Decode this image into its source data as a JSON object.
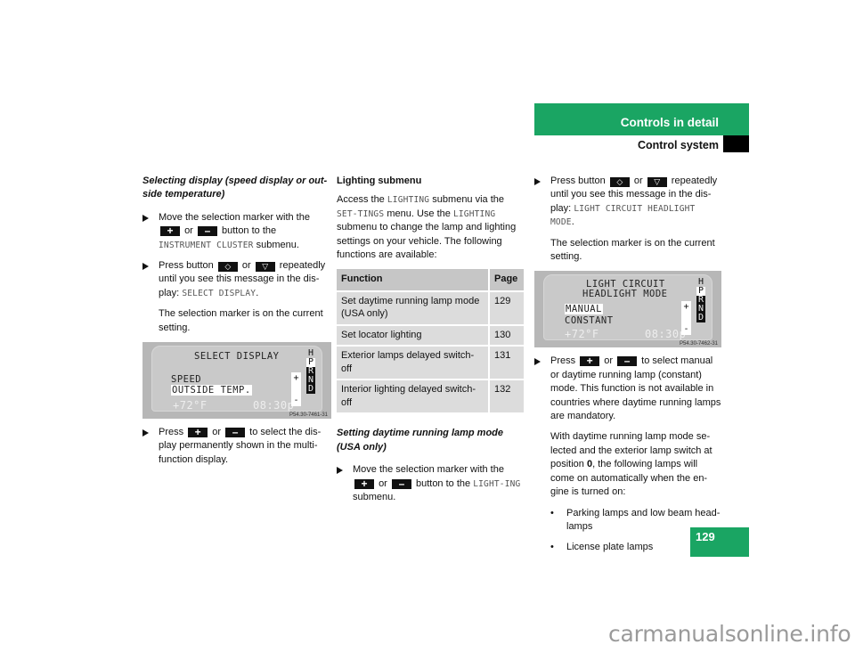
{
  "header": {
    "section": "Controls in detail",
    "subsection": "Control system"
  },
  "page_number": "129",
  "watermark": "carmanualsonline.info",
  "keys": {
    "plus": "+",
    "minus": "–",
    "up": "◇",
    "down": "▽"
  },
  "col1": {
    "heading": "Selecting display (speed display or out-side temperature)",
    "step1": {
      "a": "Move the selection marker with the",
      "or": "or",
      "b": "button to the",
      "mono": "INSTRUMENT CLUSTER",
      "c": "submenu."
    },
    "step2": {
      "a": "Press button",
      "or": "or",
      "b": "repeatedly until you see this message in the dis-play:",
      "mono": "SELECT DISPLAY",
      "end": "."
    },
    "note": "The selection marker is on the current setting.",
    "display": {
      "title": "SELECT DISPLAY",
      "option1": "SPEED",
      "option2": "OUTSIDE TEMP.",
      "temp": "+72°F",
      "time": "08:30p",
      "plus": "+",
      "minus": "-",
      "gears": [
        "H",
        "P",
        "R",
        "N",
        "D"
      ],
      "ref": "P54.30-7461-31"
    },
    "step3": {
      "a": "Press",
      "or": "or",
      "b": "to select the dis-play permanently shown in the multi-function display."
    }
  },
  "col2": {
    "heading": "Lighting submenu",
    "intro": {
      "a": "Access the",
      "m1": "LIGHTING",
      "b": "submenu via the",
      "m2": "SET-TINGS",
      "c": "menu. Use the",
      "m3": "LIGHTING",
      "d": "submenu to change the lamp and lighting settings on your vehicle. The following functions are available:"
    },
    "table": {
      "headers": [
        "Function",
        "Page"
      ],
      "rows": [
        [
          "Set daytime running lamp mode (USA only)",
          "129"
        ],
        [
          "Set locator lighting",
          "130"
        ],
        [
          "Exterior lamps delayed switch-off",
          "131"
        ],
        [
          "Interior lighting delayed switch-off",
          "132"
        ]
      ]
    },
    "heading2": "Setting daytime running lamp mode (USA only)",
    "step1": {
      "a": "Move the selection marker with the",
      "or": "or",
      "b": "button to the",
      "mono": "LIGHT-ING",
      "c": "submenu."
    }
  },
  "col3": {
    "step1": {
      "a": "Press button",
      "or": "or",
      "b": "repeatedly until you see this message in the dis-play:",
      "mono": "LIGHT CIRCUIT HEADLIGHT MODE",
      "end": "."
    },
    "note": "The selection marker is on the current setting.",
    "display": {
      "title1": "LIGHT CIRCUIT",
      "title2": "HEADLIGHT MODE",
      "option1": "MANUAL",
      "option2": "CONSTANT",
      "temp": "+72°F",
      "time": "08:30p",
      "plus": "+",
      "minus": "-",
      "gears": [
        "H",
        "P",
        "R",
        "N",
        "D"
      ],
      "ref": "P54.30-7462-31"
    },
    "step2": {
      "a": "Press",
      "or": "or",
      "b": "to select manual or daytime running lamp (constant) mode. This function is not available in countries where daytime running lamps are mandatory."
    },
    "para": {
      "a": "With daytime running lamp mode se-lected and the exterior lamp switch at position",
      "bold": "0",
      "b": ", the following lamps will come on automatically when the en-gine is turned on:"
    },
    "bullets": [
      "Parking lamps and low beam head-lamps",
      "License plate lamps"
    ],
    "continued": "▷▷"
  }
}
